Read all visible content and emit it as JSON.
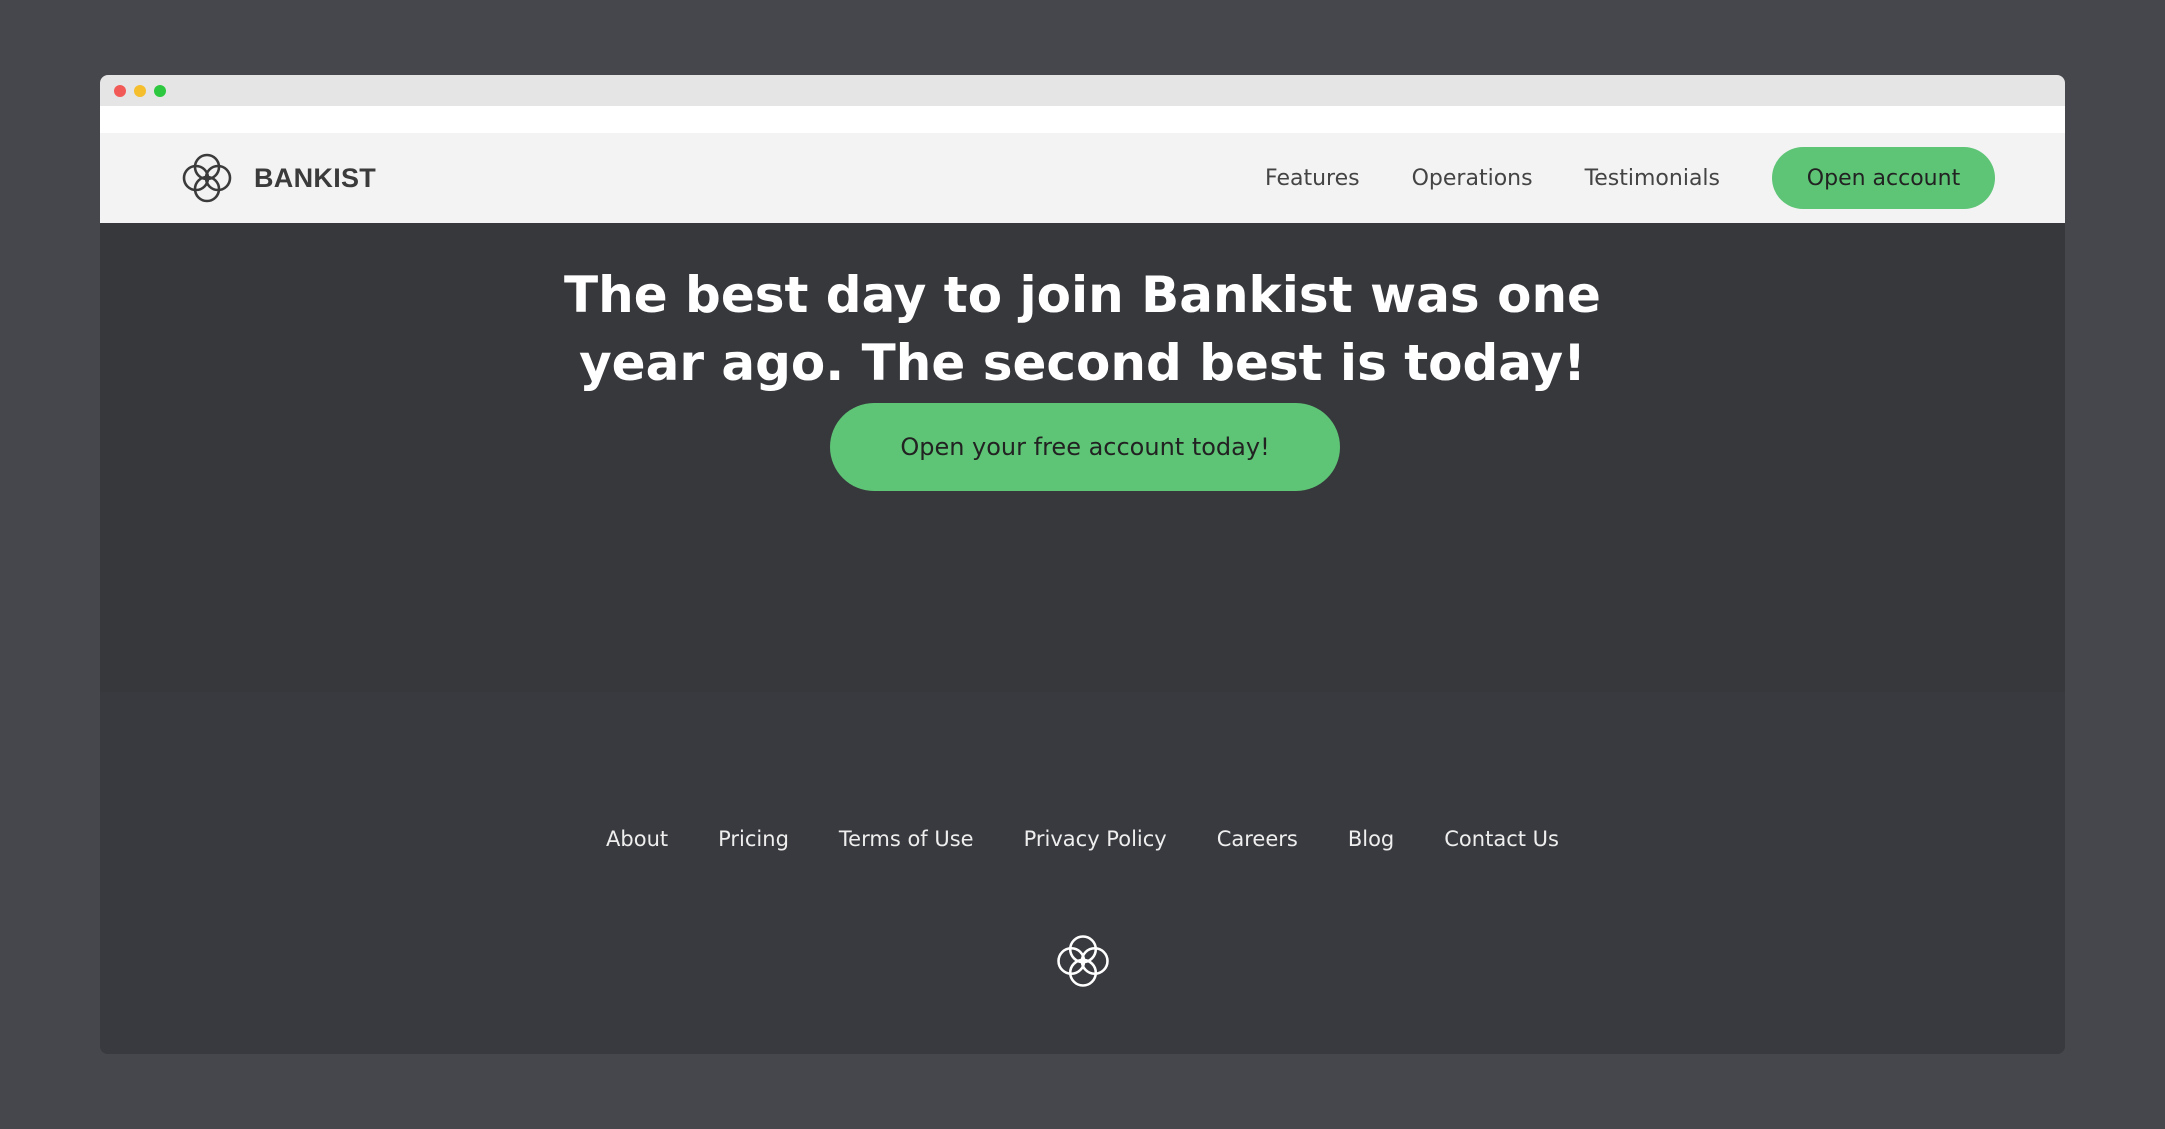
{
  "window": {
    "controls": [
      "close",
      "minimize",
      "maximize"
    ]
  },
  "nav": {
    "brand": "BANKIST",
    "logo_icon": "bankist-logo-icon",
    "links": [
      "Features",
      "Operations",
      "Testimonials"
    ],
    "cta": "Open account"
  },
  "hero": {
    "title_line1": "The best day to join Bankist was one",
    "title_line2": "year ago. The second best is today!",
    "cta": "Open your free account today!"
  },
  "footer": {
    "links": [
      "About",
      "Pricing",
      "Terms of Use",
      "Privacy Policy",
      "Careers",
      "Blog",
      "Contact Us"
    ],
    "logo_icon": "bankist-logo-icon"
  },
  "colors": {
    "accent": "#5ec576",
    "background": "#46474c",
    "dark_section": "#37383c",
    "nav_bg": "#f3f3f3"
  }
}
